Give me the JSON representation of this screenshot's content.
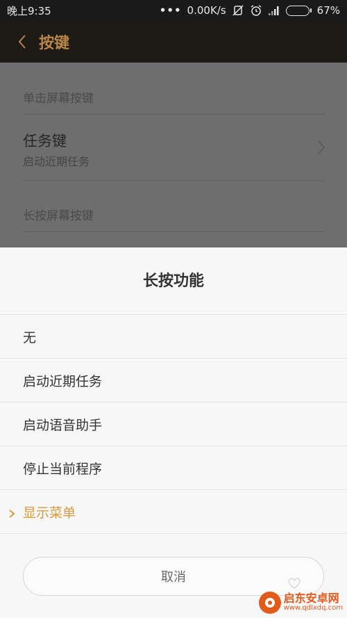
{
  "statusbar": {
    "time": "晚上9:35",
    "dots": "•••",
    "speed": "0.00K/s",
    "battery_pct": "67%",
    "battery_level": 0.67,
    "icons": [
      "no-vibrate-icon",
      "alarm-icon",
      "signal-icon",
      "battery-icon"
    ]
  },
  "appbar": {
    "back_icon": "chevron-left-icon",
    "title": "按键",
    "accent_color": "#b7854a"
  },
  "settings": {
    "section1_header": "单击屏幕按键",
    "row_title": "任务键",
    "row_subtitle": "启动近期任务",
    "section2_header": "长按屏幕按键"
  },
  "sheet": {
    "title": "长按功能",
    "options": [
      {
        "label": "无",
        "selected": false
      },
      {
        "label": "启动近期任务",
        "selected": false
      },
      {
        "label": "启动语音助手",
        "selected": false
      },
      {
        "label": "停止当前程序",
        "selected": false
      },
      {
        "label": "显示菜单",
        "selected": true
      }
    ],
    "selected_color": "#d59a3e",
    "cancel_label": "取消"
  },
  "watermark": {
    "name": "启东安卓网",
    "url": "www.qdlxdq.com"
  }
}
